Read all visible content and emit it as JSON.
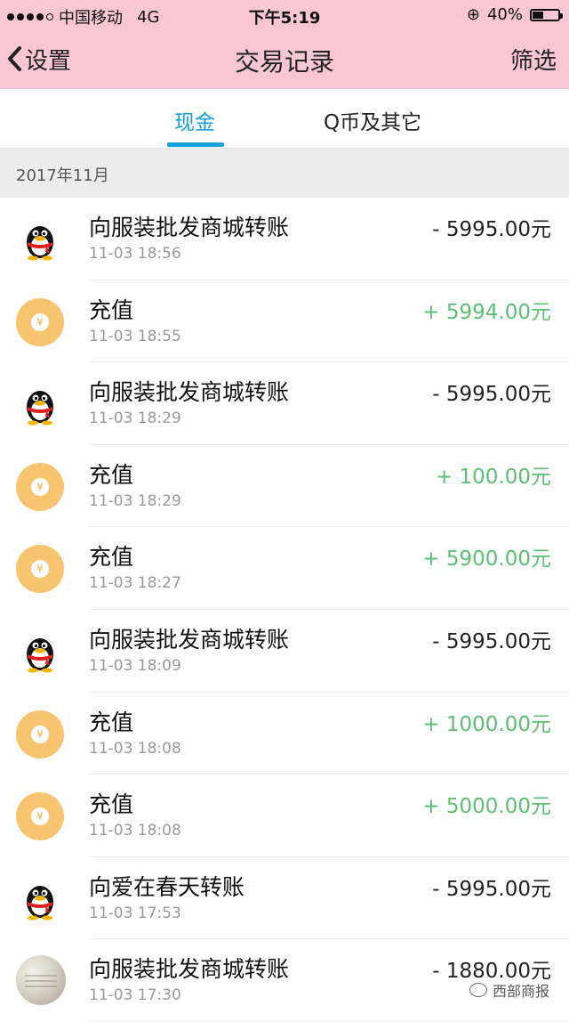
{
  "status_bar": {
    "carrier": "中国移动",
    "network": "4G",
    "time": "下午5:19",
    "battery": "40%",
    "lock_glyph": "⊕"
  },
  "nav": {
    "back_label": "设置",
    "title": "交易记录",
    "filter_label": "筛选"
  },
  "tabs": [
    {
      "label": "现金",
      "active": true
    },
    {
      "label": "Q币及其它",
      "active": false
    }
  ],
  "month_header": "2017年11月",
  "transactions": [
    {
      "icon": "qq-penguin-icon",
      "title": "向服装批发商城转账",
      "time": "11-03 18:56",
      "amount": "- 5995.00元",
      "type": "out"
    },
    {
      "icon": "coin-icon",
      "title": "充值",
      "time": "11-03 18:55",
      "amount": "+ 5994.00元",
      "type": "in"
    },
    {
      "icon": "qq-penguin-icon",
      "title": "向服装批发商城转账",
      "time": "11-03 18:29",
      "amount": "- 5995.00元",
      "type": "out"
    },
    {
      "icon": "coin-icon",
      "title": "充值",
      "time": "11-03 18:29",
      "amount": "+ 100.00元",
      "type": "in"
    },
    {
      "icon": "coin-icon",
      "title": "充值",
      "time": "11-03 18:27",
      "amount": "+ 5900.00元",
      "type": "in"
    },
    {
      "icon": "qq-penguin-icon",
      "title": "向服装批发商城转账",
      "time": "11-03 18:09",
      "amount": "- 5995.00元",
      "type": "out"
    },
    {
      "icon": "coin-icon",
      "title": "充值",
      "time": "11-03 18:08",
      "amount": "+ 1000.00元",
      "type": "in"
    },
    {
      "icon": "coin-icon",
      "title": "充值",
      "time": "11-03 18:08",
      "amount": "+ 5000.00元",
      "type": "in"
    },
    {
      "icon": "qq-penguin-icon",
      "title": "向爱在春天转账",
      "time": "11-03 17:53",
      "amount": "- 5995.00元",
      "type": "out"
    },
    {
      "icon": "photo-avatar",
      "title": "向服装批发商城转账",
      "time": "11-03 17:30",
      "amount": "- 1880.00元",
      "type": "out"
    }
  ],
  "coin_glyph": "¥",
  "watermark": "西部商报",
  "colors": {
    "header_bg": "#f8c6d4",
    "accent": "#16a0d8",
    "positive": "#5cbf74",
    "coin": "#f7c46f"
  }
}
